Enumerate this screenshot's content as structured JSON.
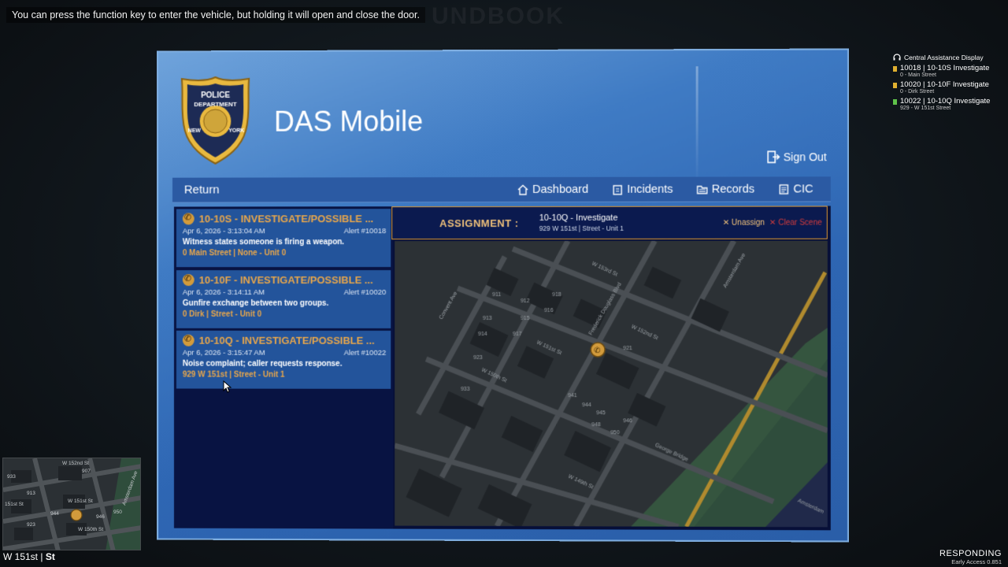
{
  "hint": "You can press the function key to enter the vehicle, but holding it will open and close the door.",
  "app": {
    "title": "DAS Mobile",
    "sign_out": "Sign Out",
    "badge_text": [
      "POLICE",
      "DEPARTMENT",
      "NEW",
      "YORK"
    ]
  },
  "nav": {
    "return": "Return",
    "items": [
      {
        "label": "Dashboard",
        "icon": "house-icon"
      },
      {
        "label": "Incidents",
        "icon": "clipboard-icon"
      },
      {
        "label": "Records",
        "icon": "folder-icon"
      },
      {
        "label": "CIC",
        "icon": "document-icon"
      }
    ]
  },
  "incidents": [
    {
      "title": "10-10S - INVESTIGATE/POSSIBLE ...",
      "date": "Apr 6, 2026 - 3:13:04 AM",
      "alert": "Alert #10018",
      "desc": "Witness states someone is firing a weapon.",
      "loc": "0 Main Street | None - Unit 0"
    },
    {
      "title": "10-10F - INVESTIGATE/POSSIBLE ...",
      "date": "Apr 6, 2026 - 3:14:11 AM",
      "alert": "Alert #10020",
      "desc": "Gunfire exchange between two groups.",
      "loc": "0 Dirk | Street - Unit 0"
    },
    {
      "title": "10-10Q - INVESTIGATE/POSSIBLE ...",
      "date": "Apr 6, 2026 - 3:15:47 AM",
      "alert": "Alert #10022",
      "desc": "Noise complaint; caller requests response.",
      "loc": "929 W 151st | Street - Unit 1"
    }
  ],
  "assignment": {
    "label": "ASSIGNMENT :",
    "title": "10-10Q - Investigate",
    "subtitle": "929 W 151st | Street - Unit 1",
    "unassign": "Unassign",
    "clear": "Clear Scene"
  },
  "map_labels": {
    "streets": [
      "W 153rd St",
      "W 152nd St",
      "W 151st St",
      "W 150th St",
      "W 149th St",
      "Amsterdam Ave",
      "Convent Ave",
      "Frederick Douglass Blvd",
      "George Bridge",
      "Amsterdam"
    ],
    "buildings": [
      "911",
      "912",
      "913",
      "914",
      "915",
      "916",
      "917",
      "918",
      "921",
      "923",
      "933",
      "941",
      "944",
      "945",
      "946",
      "948",
      "950"
    ]
  },
  "cad": {
    "header": "Central Assistance Display",
    "rows": [
      {
        "title": "10018 | 10-10S Investigate",
        "sub": "0 - Main Street",
        "color": "#e0b030"
      },
      {
        "title": "10020 | 10-10F Investigate",
        "sub": "0 - Dirk Street",
        "color": "#e0b030"
      },
      {
        "title": "10022 | 10-10Q Investigate",
        "sub": "929 - W 151st Street",
        "color": "#5fc24a"
      }
    ]
  },
  "minimap_labels": [
    "W 152nd St",
    "W 151st St",
    "151st St",
    "W 150th St",
    "933",
    "907",
    "913",
    "923",
    "944",
    "946",
    "950",
    "Amsterdam Ave"
  ],
  "street": {
    "name": "W 151st",
    "suffix": "St"
  },
  "status": {
    "state": "RESPONDING",
    "version": "Early Access 0.851"
  },
  "colors": {
    "accent_orange": "#e7a64b",
    "panel_blue": "#23549b",
    "screen_blue": "#2e66b3",
    "clear_red": "#d33b3b"
  }
}
